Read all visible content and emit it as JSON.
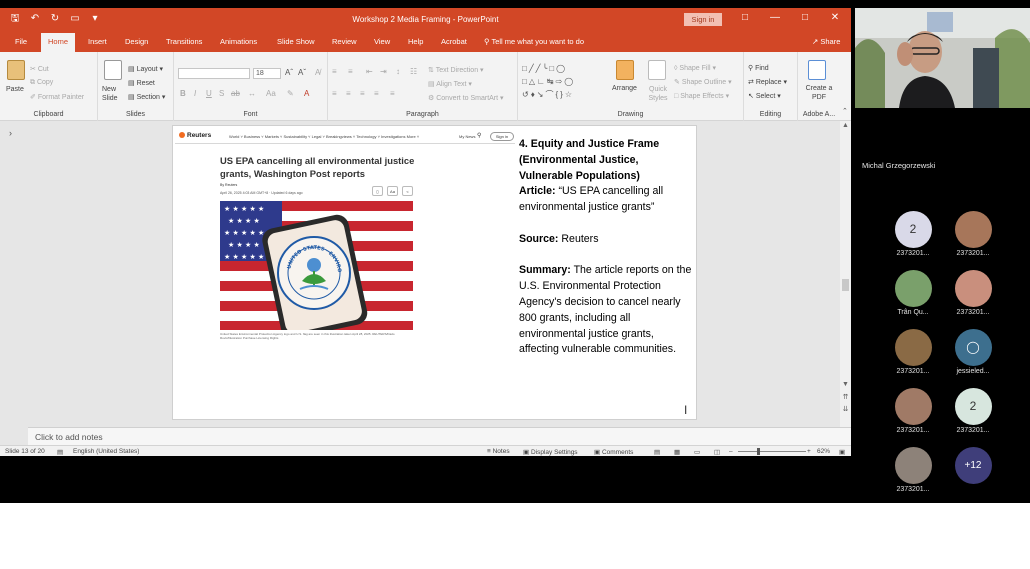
{
  "ppt": {
    "title": "Workshop 2 Media Framing  -  PowerPoint",
    "signin": "Sign in",
    "tabs": [
      "File",
      "Home",
      "Insert",
      "Design",
      "Transitions",
      "Animations",
      "Slide Show",
      "Review",
      "View",
      "Help",
      "Acrobat"
    ],
    "tell_me": "Tell me what you want to do",
    "share": "Share",
    "ribbon": {
      "clipboard": {
        "label": "Clipboard",
        "paste": "Paste",
        "cut": "Cut",
        "copy": "Copy",
        "format_painter": "Format Painter"
      },
      "slides": {
        "label": "Slides",
        "new_slide": "New Slide",
        "layout": "Layout",
        "reset": "Reset",
        "section": "Section"
      },
      "font": {
        "label": "Font",
        "font_size": "18"
      },
      "paragraph": {
        "label": "Paragraph",
        "text_direction": "Text Direction",
        "align_text": "Align Text",
        "convert": "Convert to SmartArt"
      },
      "drawing": {
        "label": "Drawing",
        "arrange": "Arrange",
        "quick_styles": "Quick Styles",
        "shape_fill": "Shape Fill",
        "shape_outline": "Shape Outline",
        "shape_effects": "Shape Effects"
      },
      "editing": {
        "label": "Editing",
        "find": "Find",
        "replace": "Replace",
        "select": "Select"
      },
      "adobe": {
        "label": "Adobe A...",
        "create_pdf": "Create a PDF"
      }
    },
    "notes_placeholder": "Click to add notes",
    "status": {
      "slide": "Slide 13 of 20",
      "language": "English (United States)",
      "notes": "Notes",
      "display": "Display Settings",
      "comments": "Comments",
      "zoom": "62%"
    }
  },
  "slide": {
    "reuters": {
      "logo": "Reuters",
      "nav": "World ˅   Business ˅   Markets ˅   Sustainability ˅   Legal ˅   Breakingviews ˅   Technology ˅   Investigations   More ˅",
      "my_news": "My News",
      "sign_in": "Sign in",
      "headline": "US EPA cancelling all environmental justice grants, Washington Post reports",
      "byline": "By Reuters",
      "date": "April 26, 2025 4:03 AM GMT+8 · Updated 6 days ago",
      "tool_text": "Aa",
      "seal_text": "UNITED STATES · ENVIRONMENTAL PROTECTION AGENCY",
      "caption": "United States Environmental Protection Agency logo and U.S. flag are seen in this illustration taken April 28, 2025. REUTERS/Dado Ruvic/Illustration Purchase Licensing Rights"
    },
    "frame_title": "4. Equity and Justice Frame (Environmental Justice, Vulnerable Populations)",
    "article_label": "Article:",
    "article_text": " “US EPA cancelling all environmental justice grants”",
    "source_label": "Source:",
    "source_text": " Reuters",
    "summary_label": "Summary:",
    "summary_text": " The article reports on the U.S. Environmental Protection Agency's decision to cancel nearly 800 grants, including all environmental justice grants, affecting vulnerable communities."
  },
  "meeting": {
    "speaker_name": "Michal Grzegorzewski",
    "participants": [
      {
        "name": "2373201...",
        "avatar_text": "2",
        "color": "#d9d9e8"
      },
      {
        "name": "2373201...",
        "avatar_text": "",
        "color": "#a7765a"
      },
      {
        "name": "Trân Qu...",
        "avatar_text": "",
        "color": "#7aa06b"
      },
      {
        "name": "2373201...",
        "avatar_text": "",
        "color": "#c98f7d"
      },
      {
        "name": "2373201...",
        "avatar_text": "",
        "color": "#8a6a45"
      },
      {
        "name": "jessieled...",
        "avatar_text": "",
        "color": "#3d6f8e"
      },
      {
        "name": "2373201...",
        "avatar_text": "",
        "color": "#a07a66"
      },
      {
        "name": "2373201...",
        "avatar_text": "2",
        "color": "#d7e6de"
      },
      {
        "name": "2373201...",
        "avatar_text": "",
        "color": "#8d8279"
      },
      {
        "name": "",
        "avatar_text": "+12",
        "color": "#3f3e7a"
      }
    ]
  }
}
